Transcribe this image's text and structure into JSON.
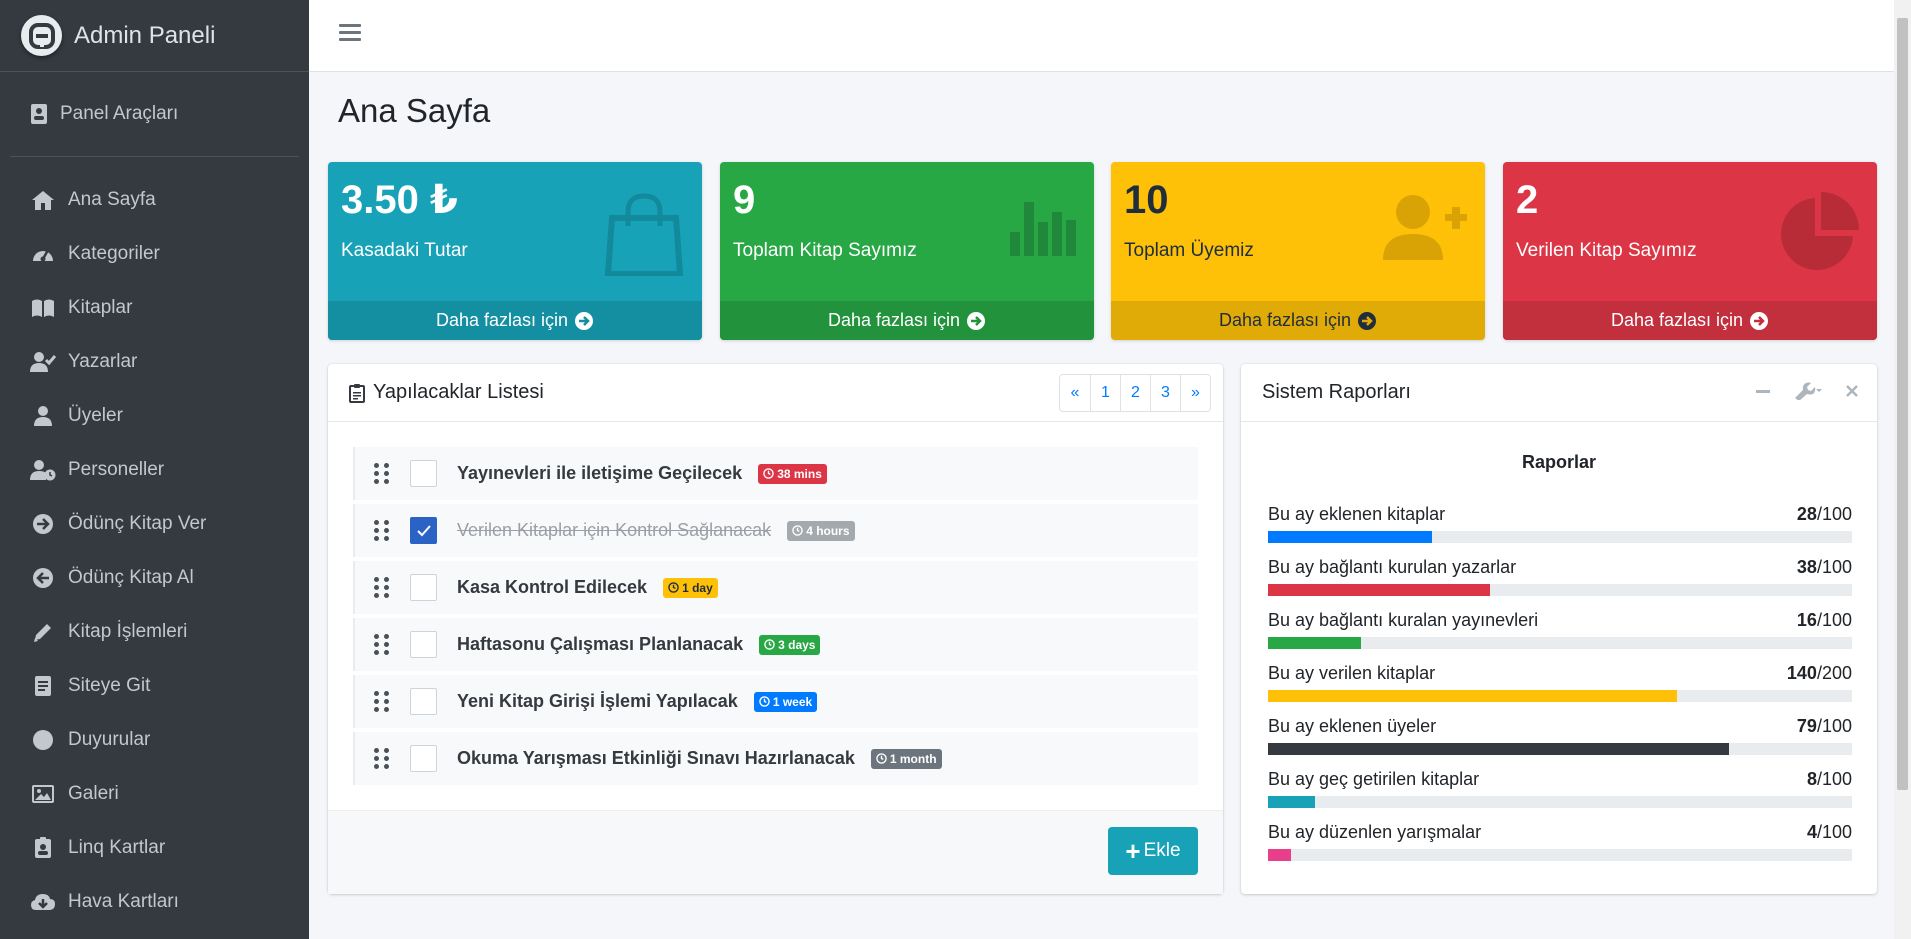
{
  "sidebar": {
    "brand": "Admin Paneli",
    "panel_tools": "Panel Araçları",
    "items": [
      {
        "label": "Ana Sayfa",
        "icon": "home-icon"
      },
      {
        "label": "Kategoriler",
        "icon": "tachometer-icon"
      },
      {
        "label": "Kitaplar",
        "icon": "book-icon"
      },
      {
        "label": "Yazarlar",
        "icon": "user-check-icon"
      },
      {
        "label": "Üyeler",
        "icon": "user-icon"
      },
      {
        "label": "Personeller",
        "icon": "user-clock-icon"
      },
      {
        "label": "Ödünç Kitap Ver",
        "icon": "arrow-circle-right-icon"
      },
      {
        "label": "Ödünç Kitap Al",
        "icon": "arrow-circle-left-icon"
      },
      {
        "label": "Kitap İşlemleri",
        "icon": "pen-icon"
      },
      {
        "label": "Siteye Git",
        "icon": "document-icon"
      },
      {
        "label": "Duyurular",
        "icon": "circle-icon"
      },
      {
        "label": "Galeri",
        "icon": "image-icon"
      },
      {
        "label": "Linq Kartlar",
        "icon": "id-badge-icon"
      },
      {
        "label": "Hava Kartları",
        "icon": "cloud-download-icon"
      }
    ]
  },
  "page": {
    "title": "Ana Sayfa"
  },
  "stats": [
    {
      "value": "3.50 ₺",
      "label": "Kasadaki Tutar",
      "footer": "Daha fazlası için",
      "icon": "shopping-bag-icon",
      "color": "#17a2b8"
    },
    {
      "value": "9",
      "label": "Toplam Kitap Sayımız",
      "footer": "Daha fazlası için",
      "icon": "bar-chart-icon",
      "color": "#28a745"
    },
    {
      "value": "10",
      "label": "Toplam Üyemiz",
      "footer": "Daha fazlası için",
      "icon": "user-plus-icon",
      "color": "#ffc107"
    },
    {
      "value": "2",
      "label": "Verilen Kitap Sayımız",
      "footer": "Daha fazlası için",
      "icon": "pie-chart-icon",
      "color": "#dc3545"
    }
  ],
  "todo": {
    "title": "Yapılacaklar Listesi",
    "pagination": [
      "«",
      "1",
      "2",
      "3",
      "»"
    ],
    "items": [
      {
        "text": "Yayınevleri ile iletişime Geçilecek",
        "badge": "38 mins",
        "badge_color": "#dc3545",
        "checked": false
      },
      {
        "text": "Verilen Kitaplar için Kontrol Sağlanacak",
        "badge": "4 hours",
        "badge_color": "#a4a9ae",
        "checked": true
      },
      {
        "text": "Kasa Kontrol Edilecek",
        "badge": "1 day",
        "badge_color": "#ffc107",
        "checked": false
      },
      {
        "text": "Haftasonu Çalışması Planlanacak",
        "badge": "3 days",
        "badge_color": "#28a745",
        "checked": false
      },
      {
        "text": "Yeni Kitap Girişi İşlemi Yapılacak",
        "badge": "1 week",
        "badge_color": "#007bff",
        "checked": false
      },
      {
        "text": "Okuma Yarışması Etkinliği Sınavı Hazırlanacak",
        "badge": "1 month",
        "badge_color": "#6c757d",
        "checked": false
      }
    ],
    "add_label": "Ekle"
  },
  "reports": {
    "title": "Sistem Raporları",
    "subtitle": "Raporlar",
    "items": [
      {
        "label": "Bu ay eklenen kitaplar",
        "value": "28",
        "total": "/100",
        "fraction": 0.28,
        "color": "#007bff"
      },
      {
        "label": "Bu ay bağlantı kurulan yazarlar",
        "value": "38",
        "total": "/100",
        "fraction": 0.38,
        "color": "#dc3545"
      },
      {
        "label": "Bu ay bağlantı kuralan yayınevleri",
        "value": "16",
        "total": "/100",
        "fraction": 0.16,
        "color": "#28a745"
      },
      {
        "label": "Bu ay verilen kitaplar",
        "value": "140",
        "total": "/200",
        "fraction": 0.7,
        "color": "#ffc107"
      },
      {
        "label": "Bu ay eklenen üyeler",
        "value": "79",
        "total": "/100",
        "fraction": 0.79,
        "color": "#343a40"
      },
      {
        "label": "Bu ay geç getirilen kitaplar",
        "value": "8",
        "total": "/100",
        "fraction": 0.08,
        "color": "#17a2b8"
      },
      {
        "label": "Bu ay düzenlen yarışmalar",
        "value": "4",
        "total": "/100",
        "fraction": 0.04,
        "color": "#e83e8c"
      }
    ]
  }
}
